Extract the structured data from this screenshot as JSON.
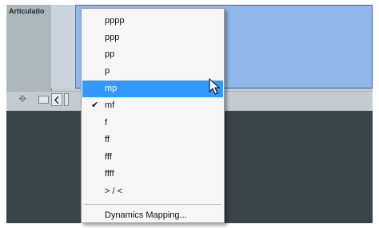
{
  "track": {
    "label": "Articulatio"
  },
  "menu": {
    "items": [
      {
        "label": "pppp",
        "checked": false,
        "highlighted": false
      },
      {
        "label": "ppp",
        "checked": false,
        "highlighted": false
      },
      {
        "label": "pp",
        "checked": false,
        "highlighted": false
      },
      {
        "label": "p",
        "checked": false,
        "highlighted": false
      },
      {
        "label": "mp",
        "checked": false,
        "highlighted": true
      },
      {
        "label": "mf",
        "checked": true,
        "highlighted": false
      },
      {
        "label": "f",
        "checked": false,
        "highlighted": false
      },
      {
        "label": "ff",
        "checked": false,
        "highlighted": false
      },
      {
        "label": "fff",
        "checked": false,
        "highlighted": false
      },
      {
        "label": "ffff",
        "checked": false,
        "highlighted": false
      },
      {
        "label": "> / <",
        "checked": false,
        "highlighted": false
      }
    ],
    "footer_item": "Dynamics Mapping...",
    "check_glyph": "✔"
  },
  "icons": {
    "add": "plus-icon",
    "lane": "box-icon",
    "scroll_left": "chevron-left-icon",
    "pointer": "mouse-pointer-icon"
  },
  "colors": {
    "highlight": "#3399ff",
    "selection": "#8fb7e9",
    "background_dark": "#3b4549"
  }
}
